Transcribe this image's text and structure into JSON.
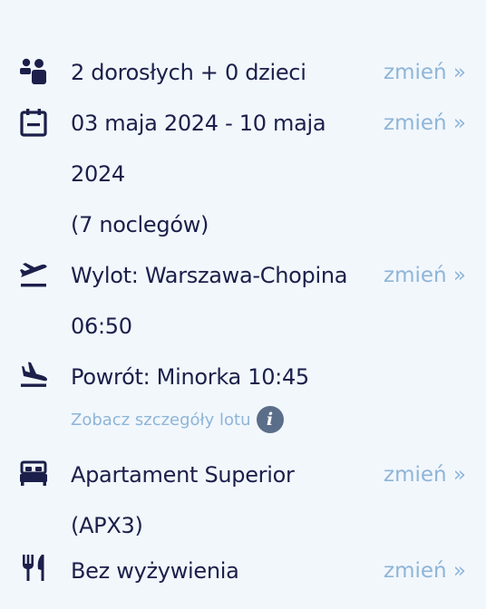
{
  "booking": {
    "travelers": {
      "text": "2 dorosłych + 0 dzieci",
      "change": "zmień »",
      "icon": "family-icon"
    },
    "dates": {
      "lines": [
        "03 maja 2024 - 10 maja",
        "2024",
        "(7 noclegów)"
      ],
      "change": "zmień »",
      "icon": "calendar-icon"
    },
    "departure": {
      "lines": [
        "Wylot: Warszawa-Chopina",
        "06:50"
      ],
      "change": "zmień »",
      "icon": "plane-takeoff-icon"
    },
    "return": {
      "text": "Powrót: Minorka 10:45",
      "details_link": "Zobacz szczegóły lotu",
      "info_glyph": "i",
      "icon": "plane-landing-icon"
    },
    "room": {
      "lines": [
        "Apartament Superior",
        "(APX3)"
      ],
      "change": "zmień »",
      "icon": "bed-icon"
    },
    "board": {
      "text": "Bez wyżywienia",
      "change": "zmień »",
      "icon": "cutlery-icon"
    }
  },
  "colors": {
    "background": "#f2f7fc",
    "text": "#1c1f4a",
    "link": "#8eb5d8",
    "info_badge": "#5a6e8a"
  }
}
